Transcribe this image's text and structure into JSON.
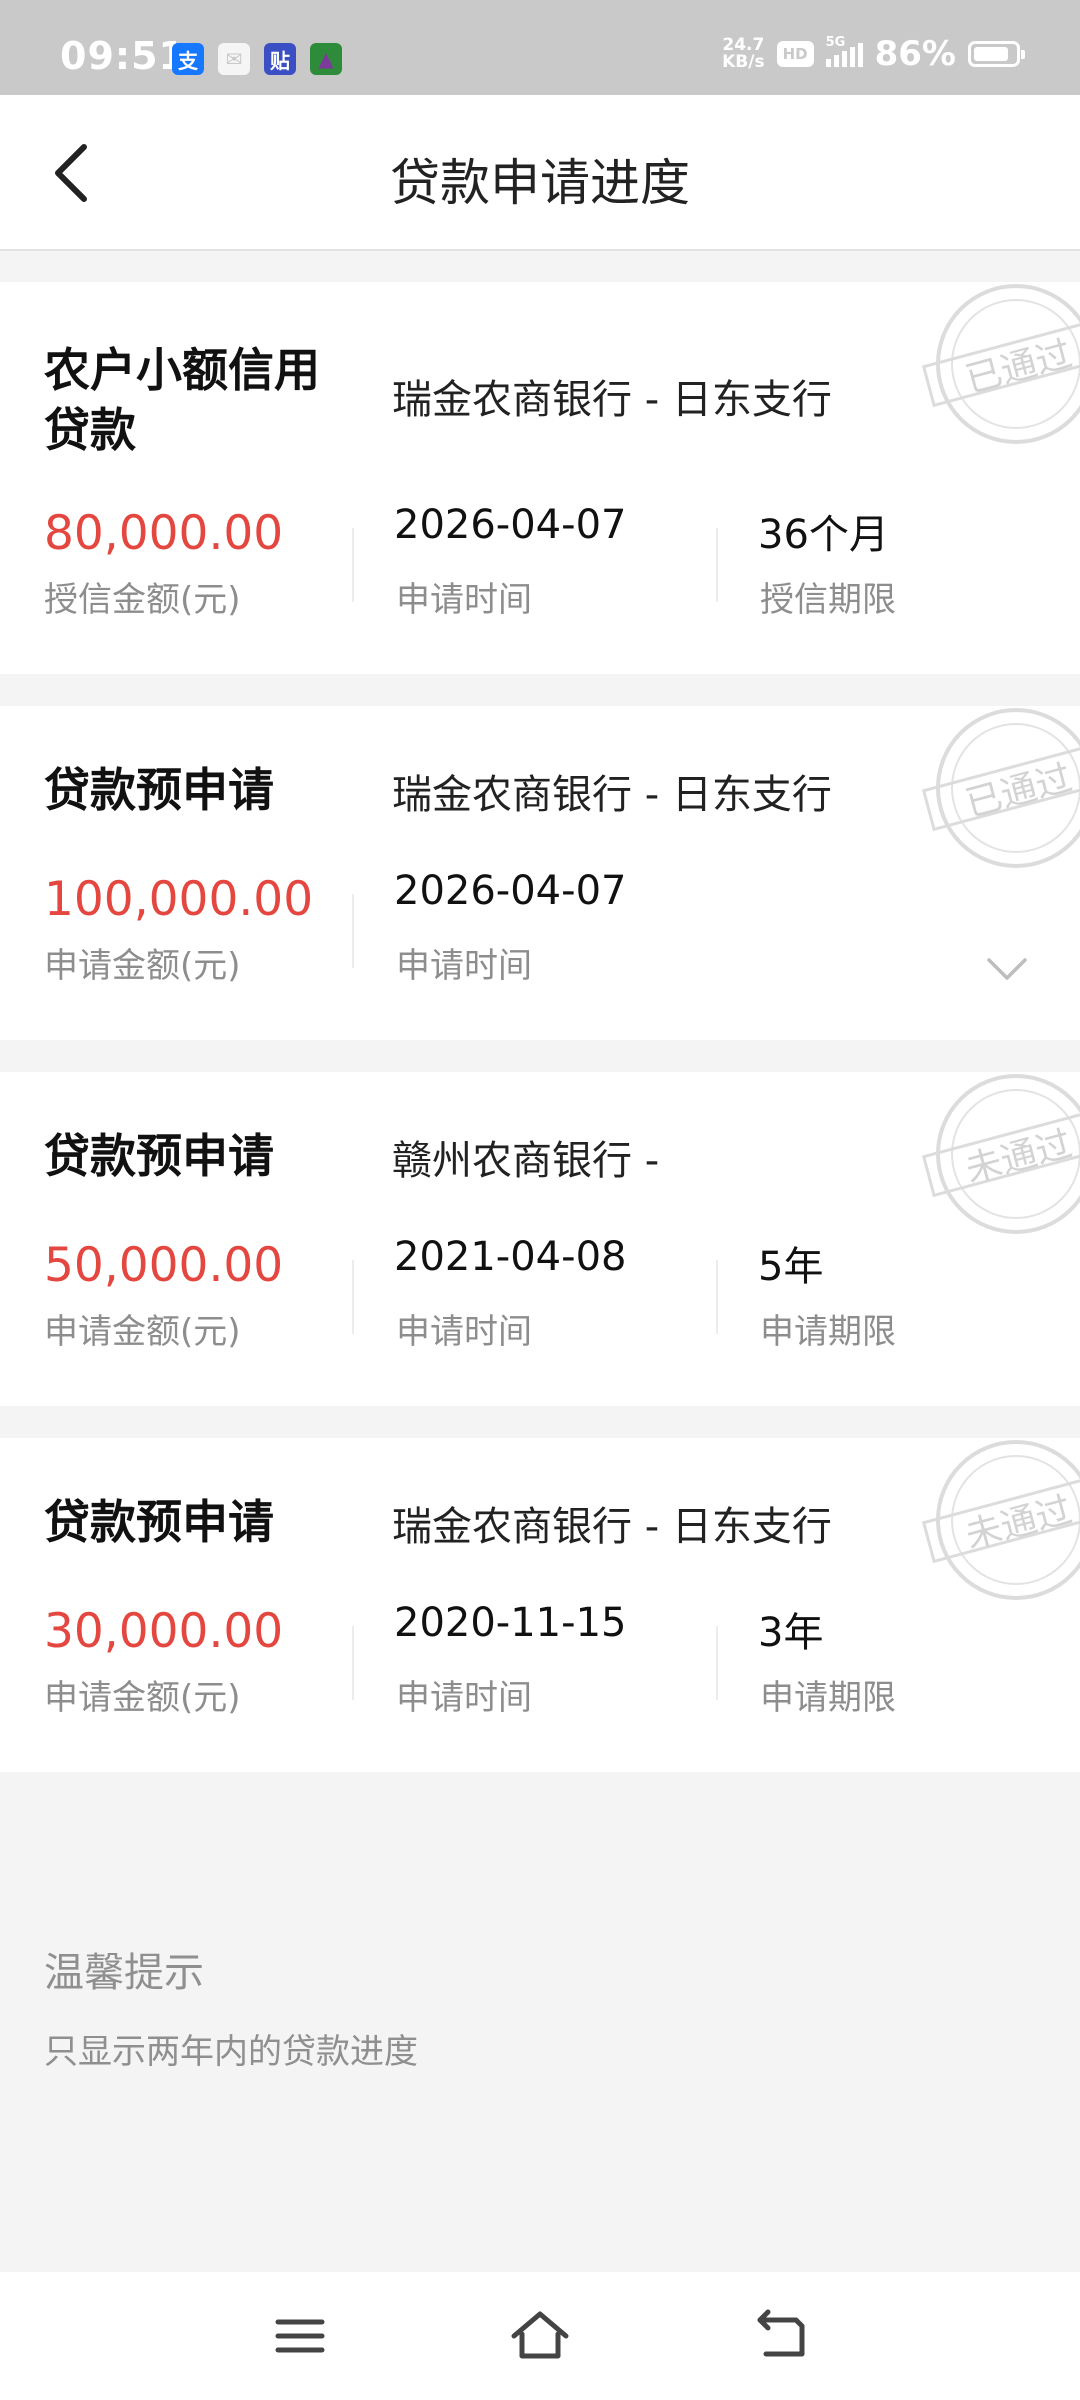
{
  "status_bar": {
    "time": "09:51",
    "app_icons": [
      {
        "icon": "alipay-icon",
        "glyph": "支",
        "color": "#1677ff"
      },
      {
        "icon": "mail-icon",
        "glyph": "✉",
        "color": "#f5f5f5"
      },
      {
        "icon": "tieba-icon",
        "glyph": "贴",
        "color": "#3b4fc4"
      },
      {
        "icon": "bank-app-icon",
        "glyph": "▲",
        "color": "#2e8b3a"
      }
    ],
    "net_speed_value": "24.7",
    "net_speed_unit": "KB/s",
    "hd_label": "HD",
    "network_type": "5G",
    "battery_percent": "86%",
    "battery_level": 0.86
  },
  "header": {
    "title": "贷款申请进度"
  },
  "loans": [
    {
      "title_line1": "农户小额信用",
      "title_line2": "贷款",
      "bank": "瑞金农商银行 - 日东支行",
      "amount": "80,000.00",
      "amount_label": "授信金额(元)",
      "date": "2026-04-07",
      "date_label": "申请时间",
      "term": "36个月",
      "term_label": "授信期限",
      "status": "已通过"
    },
    {
      "title_line1": "贷款预申请",
      "title_line2": "",
      "bank": "瑞金农商银行 - 日东支行",
      "amount": "100,000.00",
      "amount_label": "申请金额(元)",
      "date": "2026-04-07",
      "date_label": "申请时间",
      "term": "",
      "term_label": "",
      "status": "已通过"
    },
    {
      "title_line1": "贷款预申请",
      "title_line2": "",
      "bank": "赣州农商银行 -",
      "amount": "50,000.00",
      "amount_label": "申请金额(元)",
      "date": "2021-04-08",
      "date_label": "申请时间",
      "term": "5年",
      "term_label": "申请期限",
      "status": "未通过"
    },
    {
      "title_line1": "贷款预申请",
      "title_line2": "",
      "bank": "瑞金农商银行 - 日东支行",
      "amount": "30,000.00",
      "amount_label": "申请金额(元)",
      "date": "2020-11-15",
      "date_label": "申请时间",
      "term": "3年",
      "term_label": "申请期限",
      "status": "未通过"
    }
  ],
  "tips": {
    "title": "温馨提示",
    "text": "只显示两年内的贷款进度"
  },
  "nav_bar": {
    "menu_icon": "menu-icon",
    "home_icon": "home-icon",
    "back_icon": "back-icon"
  }
}
